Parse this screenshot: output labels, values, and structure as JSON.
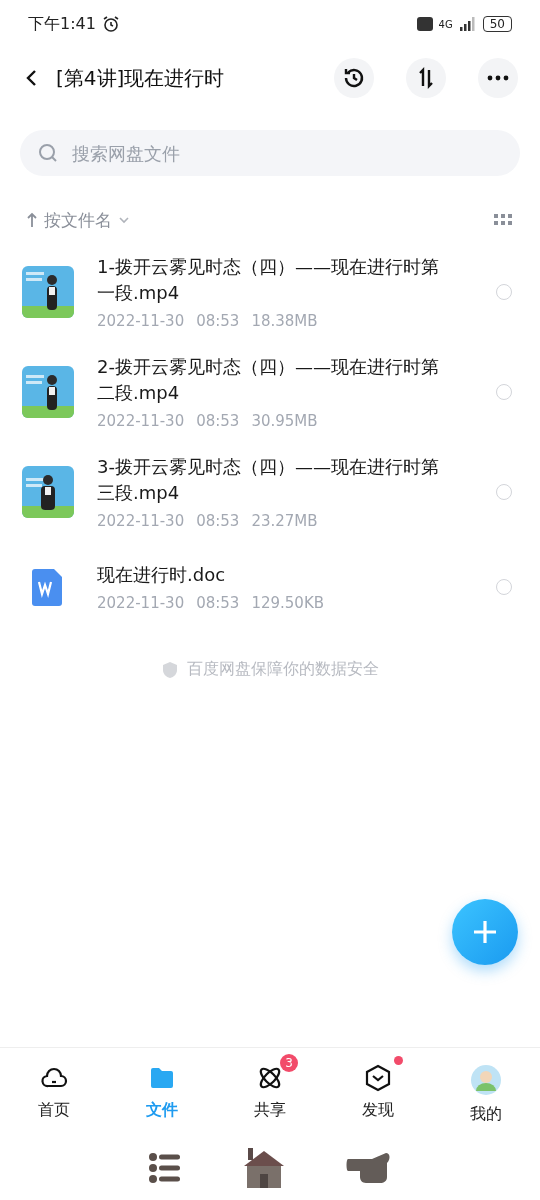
{
  "status_bar": {
    "time": "下午1:41",
    "network": "4G",
    "battery": "50"
  },
  "header": {
    "title": "[第4讲]现在进行时"
  },
  "search": {
    "placeholder": "搜索网盘文件"
  },
  "sort": {
    "label": "按文件名"
  },
  "files": [
    {
      "kind": "video",
      "name": "1-拨开云雾见时态（四）——现在进行时第一段.mp4",
      "date": "2022-11-30",
      "time": "08:53",
      "size": "18.38MB",
      "selected": false
    },
    {
      "kind": "video",
      "name": "2-拨开云雾见时态（四）——现在进行时第二段.mp4",
      "date": "2022-11-30",
      "time": "08:53",
      "size": "30.95MB",
      "selected": false
    },
    {
      "kind": "video",
      "name": "3-拨开云雾见时态（四）——现在进行时第三段.mp4",
      "date": "2022-11-30",
      "time": "08:53",
      "size": "23.27MB",
      "selected": false
    },
    {
      "kind": "doc",
      "name": "现在进行时.doc",
      "date": "2022-11-30",
      "time": "08:53",
      "size": "129.50KB",
      "selected": false
    }
  ],
  "footer_note": "百度网盘保障你的数据安全",
  "tabs": [
    {
      "kind": "home",
      "label": "首页",
      "selected": false
    },
    {
      "kind": "files",
      "label": "文件",
      "selected": true
    },
    {
      "kind": "share",
      "label": "共享",
      "selected": false,
      "badge": "3"
    },
    {
      "kind": "discover",
      "label": "发现",
      "selected": false,
      "dot": true
    },
    {
      "kind": "me",
      "label": "我的",
      "selected": false
    }
  ]
}
